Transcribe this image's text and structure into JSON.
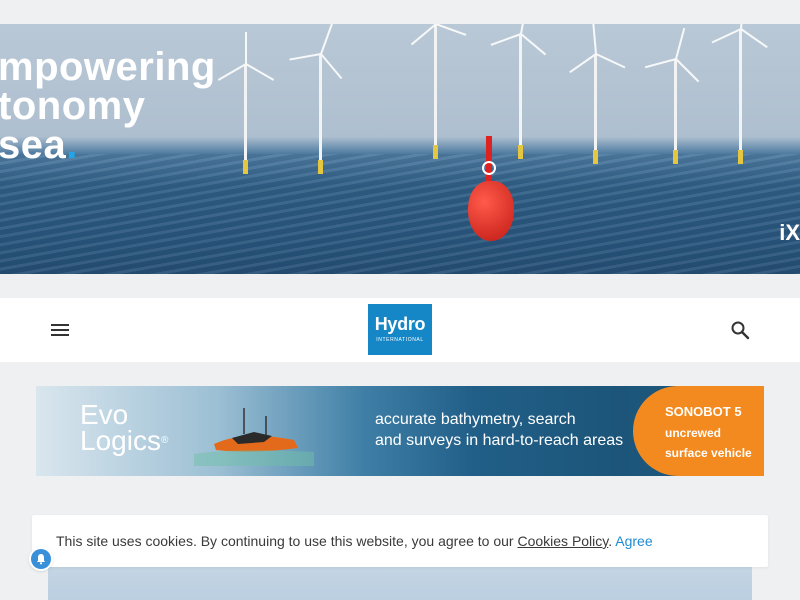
{
  "hero_ad": {
    "headline_lines": [
      "mpowering",
      "tonomy",
      "sea"
    ],
    "headline_dot": ".",
    "brand_fragment": "iX"
  },
  "header": {
    "menu_icon": "hamburger-menu-icon",
    "logo_main": "Hydro",
    "logo_sub": "INTERNATIONAL",
    "search_icon": "search-icon",
    "logo_color": "#1587c7"
  },
  "evologics_ad": {
    "logo_line1": "Evo",
    "logo_line2": "Logics",
    "logo_mark": "®",
    "tagline_line1": "accurate bathymetry, search",
    "tagline_line2": "and surveys in hard-to-reach areas",
    "product_name": "SONOBOT 5",
    "product_desc_line1": "uncrewed",
    "product_desc_line2": "surface vehicle",
    "accent_color": "#f28a1f"
  },
  "cookie_bar": {
    "message": "This site uses cookies. By continuing to use this website, you agree to our ",
    "policy_link": "Cookies Policy",
    "separator": ". ",
    "agree_label": "Agree",
    "link_color": "#1f8bd1"
  },
  "notification": {
    "icon": "bell-icon"
  }
}
